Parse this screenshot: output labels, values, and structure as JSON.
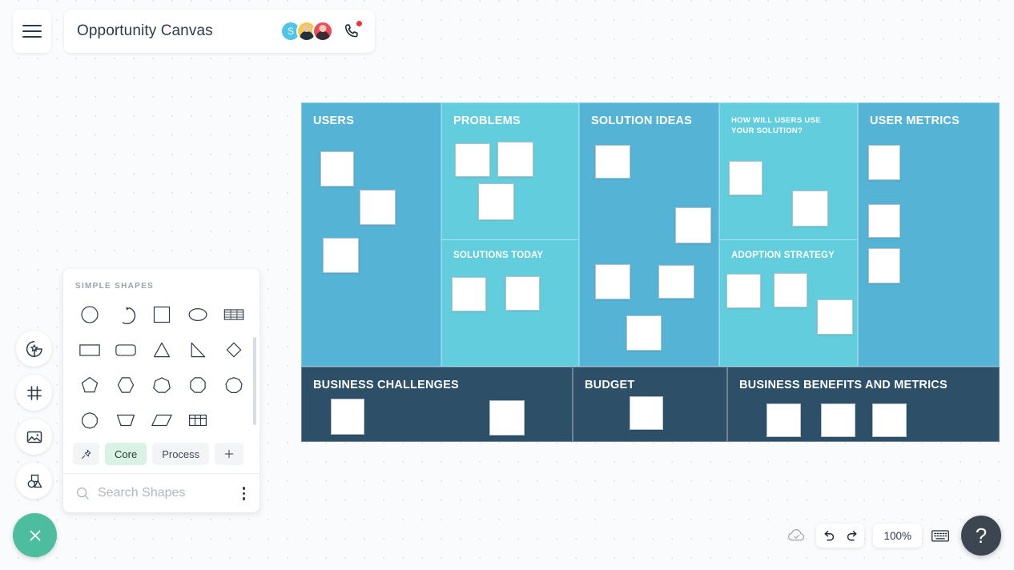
{
  "header": {
    "menu_icon": "hamburger-icon",
    "title": "Opportunity Canvas",
    "collaborators": [
      {
        "initial": "S",
        "color": "#4fc3e8",
        "type": "initial"
      },
      {
        "initial": "",
        "color": "#f7c948",
        "type": "photo"
      },
      {
        "initial": "",
        "color": "#ee4b5e",
        "type": "photo"
      }
    ],
    "call_icon": "phone-call-icon",
    "call_badge": true
  },
  "left_rail": {
    "items": [
      {
        "icon": "sticker-star-icon",
        "name": "sticky-notes-tool"
      },
      {
        "icon": "frame-icon",
        "name": "frame-tool"
      },
      {
        "icon": "image-icon",
        "name": "image-tool"
      },
      {
        "icon": "shapes-icon",
        "name": "shapes-tool"
      }
    ],
    "close_button": {
      "icon": "close-x-icon",
      "color": "#4dbd9f"
    }
  },
  "shapes_panel": {
    "header": "SIMPLE SHAPES",
    "shapes": [
      "circle",
      "arc",
      "square",
      "ellipse",
      "table-rows",
      "rectangle",
      "rounded-rectangle",
      "triangle",
      "right-triangle",
      "diamond",
      "pentagon",
      "hexagon",
      "heptagon",
      "octagon",
      "nonagon",
      "decagon",
      "trapezoid",
      "parallelogram",
      "table-grid"
    ],
    "tabs": [
      {
        "label": "",
        "icon": "pin-icon",
        "active": false
      },
      {
        "label": "Core",
        "icon": "",
        "active": true
      },
      {
        "label": "Process",
        "icon": "",
        "active": false
      },
      {
        "label": "",
        "icon": "plus-icon",
        "active": false
      }
    ],
    "search": {
      "icon": "search-icon",
      "placeholder": "Search Shapes",
      "value": ""
    },
    "overflow_icon": "kebab-menu-icon"
  },
  "canvas": {
    "background_color": "#fafbfc",
    "colors": {
      "blue": "#55b3d5",
      "cyan": "#62cedd",
      "dark": "#2d5068"
    },
    "panels": [
      {
        "title": "USERS",
        "color": "blue",
        "small_title": false,
        "notes": 3
      },
      {
        "title": "PROBLEMS",
        "color": "cyan",
        "small_title": false,
        "notes": 3
      },
      {
        "title": "SOLUTIONS TODAY",
        "color": "cyan",
        "small_title": false,
        "notes": 2
      },
      {
        "title": "SOLUTION IDEAS",
        "color": "blue",
        "small_title": false,
        "notes": 5
      },
      {
        "title": "HOW WILL USERS USE YOUR SOLUTION?",
        "color": "cyan",
        "small_title": true,
        "notes": 2
      },
      {
        "title": "ADOPTION STRATEGY",
        "color": "cyan",
        "small_title": false,
        "notes": 3
      },
      {
        "title": "USER METRICS",
        "color": "blue",
        "small_title": false,
        "notes": 3
      },
      {
        "title": "BUSINESS CHALLENGES",
        "color": "dark",
        "small_title": false,
        "notes": 2
      },
      {
        "title": "BUDGET",
        "color": "dark",
        "small_title": false,
        "notes": 1
      },
      {
        "title": "BUSINESS BENEFITS AND METRICS",
        "color": "dark",
        "small_title": false,
        "notes": 3
      }
    ]
  },
  "bottom_bar": {
    "cloud_icon": "cloud-saved-icon",
    "undo_icon": "undo-icon",
    "redo_icon": "redo-icon",
    "zoom_level": "100%",
    "keyboard_icon": "keyboard-shortcuts-icon",
    "help_label": "?"
  }
}
